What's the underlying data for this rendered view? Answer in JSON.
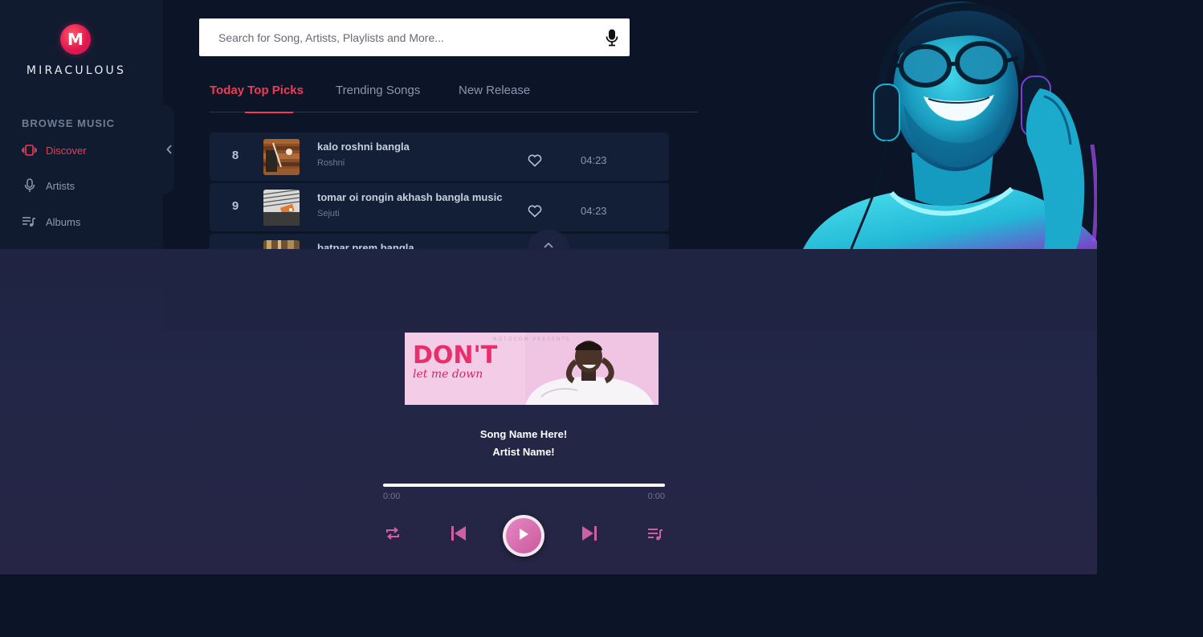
{
  "brand": {
    "logo_letter": "M",
    "name": "MIRACULOUS"
  },
  "sidebar": {
    "section_title": "BROWSE MUSIC",
    "items": [
      {
        "label": "Discover",
        "icon": "vibrate-icon",
        "active": true
      },
      {
        "label": "Artists",
        "icon": "microphone-icon",
        "active": false
      },
      {
        "label": "Albums",
        "icon": "playlist-music-icon",
        "active": false
      }
    ]
  },
  "search": {
    "placeholder": "Search for Song, Artists, Playlists and More...",
    "value": ""
  },
  "tabs": [
    {
      "label": "Today Top Picks",
      "active": true
    },
    {
      "label": "Trending Songs",
      "active": false
    },
    {
      "label": "New Release",
      "active": false
    }
  ],
  "songs": [
    {
      "number": "8",
      "title": "kalo roshni bangla",
      "artist": "Roshni",
      "duration": "04:23"
    },
    {
      "number": "9",
      "title": "tomar oi rongin akhash bangla music",
      "artist": "Sejuti",
      "duration": "04:23"
    },
    {
      "number": "",
      "title": "batpar prem bangla",
      "artist": "",
      "duration": ""
    }
  ],
  "player": {
    "song_name": "Song Name Here!",
    "artist_name": "Artist Name!",
    "current_time": "0:00",
    "total_time": "0:00",
    "progress": 0,
    "album_art": {
      "header_text": "MOTOCOM PRESENTS",
      "title_text": "DON'T",
      "script_text": "let me down"
    }
  },
  "colors": {
    "accent": "#f13a55",
    "player_accent": "#d05ea3",
    "sidebar_bg": "#111b30",
    "page_bg": "#0c1527",
    "player_bg": "#232647"
  }
}
